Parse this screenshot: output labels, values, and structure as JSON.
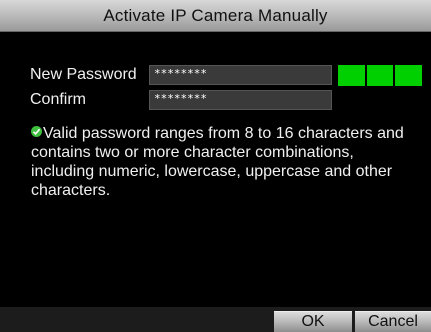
{
  "dialog": {
    "title": "Activate IP Camera Manually"
  },
  "form": {
    "new_password_label": "New Password",
    "new_password_value": "********",
    "confirm_label": "Confirm",
    "confirm_value": "********"
  },
  "strength": {
    "segments_filled": 3,
    "segments_total": 3,
    "color": "#00d000"
  },
  "info": {
    "icon": "check-circle-icon",
    "text": "Valid password ranges from 8 to 16 characters and contains two or more character combinations, including numeric, lowercase, uppercase and other characters."
  },
  "buttons": {
    "ok_label": "OK",
    "cancel_label": "Cancel"
  }
}
